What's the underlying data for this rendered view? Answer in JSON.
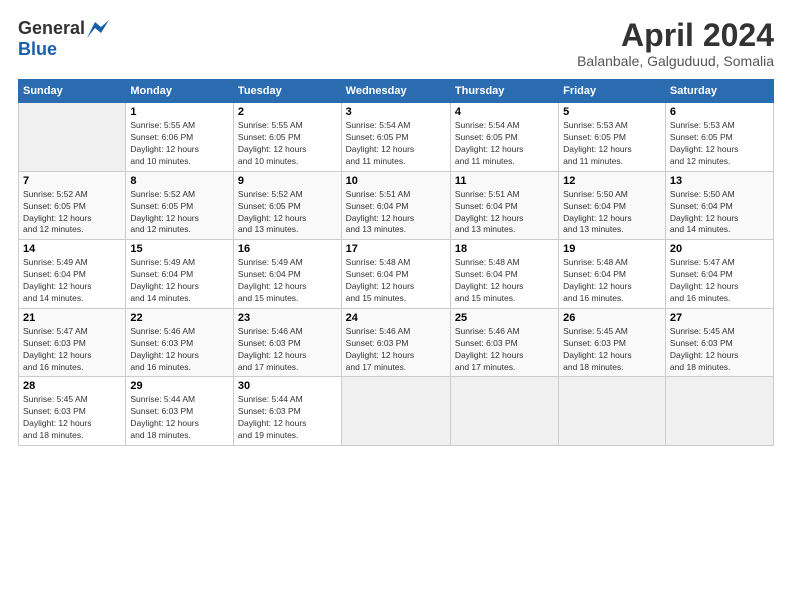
{
  "logo": {
    "general": "General",
    "blue": "Blue"
  },
  "title": "April 2024",
  "subtitle": "Balanbale, Galguduud, Somalia",
  "headers": [
    "Sunday",
    "Monday",
    "Tuesday",
    "Wednesday",
    "Thursday",
    "Friday",
    "Saturday"
  ],
  "weeks": [
    [
      {
        "day": "",
        "info": ""
      },
      {
        "day": "1",
        "info": "Sunrise: 5:55 AM\nSunset: 6:06 PM\nDaylight: 12 hours\nand 10 minutes."
      },
      {
        "day": "2",
        "info": "Sunrise: 5:55 AM\nSunset: 6:05 PM\nDaylight: 12 hours\nand 10 minutes."
      },
      {
        "day": "3",
        "info": "Sunrise: 5:54 AM\nSunset: 6:05 PM\nDaylight: 12 hours\nand 11 minutes."
      },
      {
        "day": "4",
        "info": "Sunrise: 5:54 AM\nSunset: 6:05 PM\nDaylight: 12 hours\nand 11 minutes."
      },
      {
        "day": "5",
        "info": "Sunrise: 5:53 AM\nSunset: 6:05 PM\nDaylight: 12 hours\nand 11 minutes."
      },
      {
        "day": "6",
        "info": "Sunrise: 5:53 AM\nSunset: 6:05 PM\nDaylight: 12 hours\nand 12 minutes."
      }
    ],
    [
      {
        "day": "7",
        "info": "Sunrise: 5:52 AM\nSunset: 6:05 PM\nDaylight: 12 hours\nand 12 minutes."
      },
      {
        "day": "8",
        "info": "Sunrise: 5:52 AM\nSunset: 6:05 PM\nDaylight: 12 hours\nand 12 minutes."
      },
      {
        "day": "9",
        "info": "Sunrise: 5:52 AM\nSunset: 6:05 PM\nDaylight: 12 hours\nand 13 minutes."
      },
      {
        "day": "10",
        "info": "Sunrise: 5:51 AM\nSunset: 6:04 PM\nDaylight: 12 hours\nand 13 minutes."
      },
      {
        "day": "11",
        "info": "Sunrise: 5:51 AM\nSunset: 6:04 PM\nDaylight: 12 hours\nand 13 minutes."
      },
      {
        "day": "12",
        "info": "Sunrise: 5:50 AM\nSunset: 6:04 PM\nDaylight: 12 hours\nand 13 minutes."
      },
      {
        "day": "13",
        "info": "Sunrise: 5:50 AM\nSunset: 6:04 PM\nDaylight: 12 hours\nand 14 minutes."
      }
    ],
    [
      {
        "day": "14",
        "info": "Sunrise: 5:49 AM\nSunset: 6:04 PM\nDaylight: 12 hours\nand 14 minutes."
      },
      {
        "day": "15",
        "info": "Sunrise: 5:49 AM\nSunset: 6:04 PM\nDaylight: 12 hours\nand 14 minutes."
      },
      {
        "day": "16",
        "info": "Sunrise: 5:49 AM\nSunset: 6:04 PM\nDaylight: 12 hours\nand 15 minutes."
      },
      {
        "day": "17",
        "info": "Sunrise: 5:48 AM\nSunset: 6:04 PM\nDaylight: 12 hours\nand 15 minutes."
      },
      {
        "day": "18",
        "info": "Sunrise: 5:48 AM\nSunset: 6:04 PM\nDaylight: 12 hours\nand 15 minutes."
      },
      {
        "day": "19",
        "info": "Sunrise: 5:48 AM\nSunset: 6:04 PM\nDaylight: 12 hours\nand 16 minutes."
      },
      {
        "day": "20",
        "info": "Sunrise: 5:47 AM\nSunset: 6:04 PM\nDaylight: 12 hours\nand 16 minutes."
      }
    ],
    [
      {
        "day": "21",
        "info": "Sunrise: 5:47 AM\nSunset: 6:03 PM\nDaylight: 12 hours\nand 16 minutes."
      },
      {
        "day": "22",
        "info": "Sunrise: 5:46 AM\nSunset: 6:03 PM\nDaylight: 12 hours\nand 16 minutes."
      },
      {
        "day": "23",
        "info": "Sunrise: 5:46 AM\nSunset: 6:03 PM\nDaylight: 12 hours\nand 17 minutes."
      },
      {
        "day": "24",
        "info": "Sunrise: 5:46 AM\nSunset: 6:03 PM\nDaylight: 12 hours\nand 17 minutes."
      },
      {
        "day": "25",
        "info": "Sunrise: 5:46 AM\nSunset: 6:03 PM\nDaylight: 12 hours\nand 17 minutes."
      },
      {
        "day": "26",
        "info": "Sunrise: 5:45 AM\nSunset: 6:03 PM\nDaylight: 12 hours\nand 18 minutes."
      },
      {
        "day": "27",
        "info": "Sunrise: 5:45 AM\nSunset: 6:03 PM\nDaylight: 12 hours\nand 18 minutes."
      }
    ],
    [
      {
        "day": "28",
        "info": "Sunrise: 5:45 AM\nSunset: 6:03 PM\nDaylight: 12 hours\nand 18 minutes."
      },
      {
        "day": "29",
        "info": "Sunrise: 5:44 AM\nSunset: 6:03 PM\nDaylight: 12 hours\nand 18 minutes."
      },
      {
        "day": "30",
        "info": "Sunrise: 5:44 AM\nSunset: 6:03 PM\nDaylight: 12 hours\nand 19 minutes."
      },
      {
        "day": "",
        "info": ""
      },
      {
        "day": "",
        "info": ""
      },
      {
        "day": "",
        "info": ""
      },
      {
        "day": "",
        "info": ""
      }
    ]
  ]
}
